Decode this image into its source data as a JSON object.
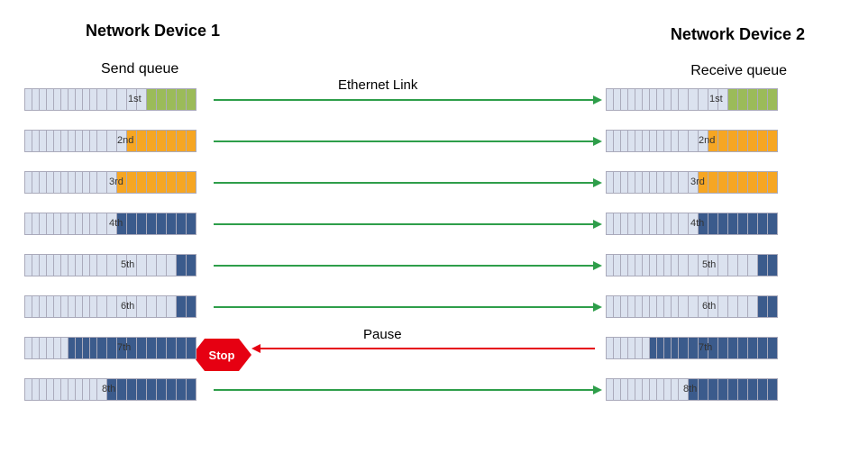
{
  "titles": {
    "left": "Network Device 1",
    "right": "Network Device 2"
  },
  "subtitles": {
    "left": "Send queue",
    "right": "Receive queue"
  },
  "labels": {
    "link": "Ethernet Link",
    "pause": "Pause",
    "stop": "Stop"
  },
  "queues": [
    {
      "label": "1st",
      "labelPos": 115,
      "slots": [
        [
          "e",
          9
        ],
        [
          "e",
          9
        ],
        [
          "e",
          9
        ],
        [
          "e",
          9
        ],
        [
          "e",
          9
        ],
        [
          "e",
          9
        ],
        [
          "e",
          9
        ],
        [
          "e",
          9
        ],
        [
          "e",
          9
        ],
        [
          "e",
          9
        ],
        [
          "e",
          12
        ],
        [
          "e",
          12
        ],
        [
          "e",
          12
        ],
        [
          "e",
          12
        ],
        [
          "e",
          12
        ],
        [
          "g",
          12
        ],
        [
          "g",
          12
        ],
        [
          "g",
          12
        ],
        [
          "g",
          12
        ],
        [
          "g",
          12
        ]
      ]
    },
    {
      "label": "2nd",
      "labelPos": 103,
      "slots": [
        [
          "e",
          9
        ],
        [
          "e",
          9
        ],
        [
          "e",
          9
        ],
        [
          "e",
          9
        ],
        [
          "e",
          9
        ],
        [
          "e",
          9
        ],
        [
          "e",
          9
        ],
        [
          "e",
          9
        ],
        [
          "e",
          9
        ],
        [
          "e",
          9
        ],
        [
          "e",
          12
        ],
        [
          "e",
          12
        ],
        [
          "e",
          12
        ],
        [
          "o",
          12
        ],
        [
          "o",
          12
        ],
        [
          "o",
          12
        ],
        [
          "o",
          12
        ],
        [
          "o",
          12
        ],
        [
          "o",
          12
        ],
        [
          "o",
          12
        ]
      ]
    },
    {
      "label": "3rd",
      "labelPos": 94,
      "slots": [
        [
          "e",
          9
        ],
        [
          "e",
          9
        ],
        [
          "e",
          9
        ],
        [
          "e",
          9
        ],
        [
          "e",
          9
        ],
        [
          "e",
          9
        ],
        [
          "e",
          9
        ],
        [
          "e",
          9
        ],
        [
          "e",
          9
        ],
        [
          "e",
          9
        ],
        [
          "e",
          12
        ],
        [
          "e",
          12
        ],
        [
          "o",
          12
        ],
        [
          "o",
          12
        ],
        [
          "o",
          12
        ],
        [
          "o",
          12
        ],
        [
          "o",
          12
        ],
        [
          "o",
          12
        ],
        [
          "o",
          12
        ],
        [
          "o",
          12
        ]
      ]
    },
    {
      "label": "4th",
      "labelPos": 94,
      "slots": [
        [
          "e",
          9
        ],
        [
          "e",
          9
        ],
        [
          "e",
          9
        ],
        [
          "e",
          9
        ],
        [
          "e",
          9
        ],
        [
          "e",
          9
        ],
        [
          "e",
          9
        ],
        [
          "e",
          9
        ],
        [
          "e",
          9
        ],
        [
          "e",
          9
        ],
        [
          "e",
          12
        ],
        [
          "e",
          12
        ],
        [
          "b",
          12
        ],
        [
          "b",
          12
        ],
        [
          "b",
          12
        ],
        [
          "b",
          12
        ],
        [
          "b",
          12
        ],
        [
          "b",
          12
        ],
        [
          "b",
          12
        ],
        [
          "b",
          12
        ]
      ]
    },
    {
      "label": "5th",
      "labelPos": 107,
      "slots": [
        [
          "e",
          9
        ],
        [
          "e",
          9
        ],
        [
          "e",
          9
        ],
        [
          "e",
          9
        ],
        [
          "e",
          9
        ],
        [
          "e",
          9
        ],
        [
          "e",
          9
        ],
        [
          "e",
          9
        ],
        [
          "e",
          9
        ],
        [
          "e",
          9
        ],
        [
          "e",
          12
        ],
        [
          "e",
          12
        ],
        [
          "e",
          12
        ],
        [
          "e",
          12
        ],
        [
          "e",
          12
        ],
        [
          "e",
          12
        ],
        [
          "e",
          12
        ],
        [
          "e",
          12
        ],
        [
          "b",
          12
        ],
        [
          "b",
          12
        ]
      ]
    },
    {
      "label": "6th",
      "labelPos": 107,
      "slots": [
        [
          "e",
          9
        ],
        [
          "e",
          9
        ],
        [
          "e",
          9
        ],
        [
          "e",
          9
        ],
        [
          "e",
          9
        ],
        [
          "e",
          9
        ],
        [
          "e",
          9
        ],
        [
          "e",
          9
        ],
        [
          "e",
          9
        ],
        [
          "e",
          9
        ],
        [
          "e",
          12
        ],
        [
          "e",
          12
        ],
        [
          "e",
          12
        ],
        [
          "e",
          12
        ],
        [
          "e",
          12
        ],
        [
          "e",
          12
        ],
        [
          "e",
          12
        ],
        [
          "e",
          12
        ],
        [
          "b",
          12
        ],
        [
          "b",
          12
        ]
      ]
    },
    {
      "label": "7th",
      "labelPos": 103,
      "slots": [
        [
          "e",
          9
        ],
        [
          "e",
          9
        ],
        [
          "e",
          9
        ],
        [
          "e",
          9
        ],
        [
          "e",
          9
        ],
        [
          "e",
          9
        ],
        [
          "b",
          9
        ],
        [
          "b",
          9
        ],
        [
          "b",
          9
        ],
        [
          "b",
          9
        ],
        [
          "b",
          12
        ],
        [
          "b",
          12
        ],
        [
          "b",
          12
        ],
        [
          "b",
          12
        ],
        [
          "b",
          12
        ],
        [
          "b",
          12
        ],
        [
          "b",
          12
        ],
        [
          "b",
          12
        ],
        [
          "b",
          12
        ],
        [
          "b",
          12
        ]
      ]
    },
    {
      "label": "8th",
      "labelPos": 86,
      "slots": [
        [
          "e",
          9
        ],
        [
          "e",
          9
        ],
        [
          "e",
          9
        ],
        [
          "e",
          9
        ],
        [
          "e",
          9
        ],
        [
          "e",
          9
        ],
        [
          "e",
          9
        ],
        [
          "e",
          9
        ],
        [
          "e",
          9
        ],
        [
          "e",
          9
        ],
        [
          "e",
          12
        ],
        [
          "b",
          12
        ],
        [
          "b",
          12
        ],
        [
          "b",
          12
        ],
        [
          "b",
          12
        ],
        [
          "b",
          12
        ],
        [
          "b",
          12
        ],
        [
          "b",
          12
        ],
        [
          "b",
          12
        ],
        [
          "b",
          12
        ]
      ]
    }
  ],
  "arrows": [
    {
      "row": 0,
      "dir": "right",
      "color": "green"
    },
    {
      "row": 1,
      "dir": "right",
      "color": "green"
    },
    {
      "row": 2,
      "dir": "right",
      "color": "green"
    },
    {
      "row": 3,
      "dir": "right",
      "color": "green"
    },
    {
      "row": 4,
      "dir": "right",
      "color": "green"
    },
    {
      "row": 5,
      "dir": "right",
      "color": "green"
    },
    {
      "row": 6,
      "dir": "left",
      "color": "red"
    },
    {
      "row": 7,
      "dir": "right",
      "color": "green"
    }
  ],
  "geometry": {
    "leftQueueX": 27,
    "rightQueueX": 672,
    "queueWidth": 210,
    "rowStart": 98,
    "rowGap": 46,
    "arrowStartX": 237,
    "arrowEndX": 660
  }
}
